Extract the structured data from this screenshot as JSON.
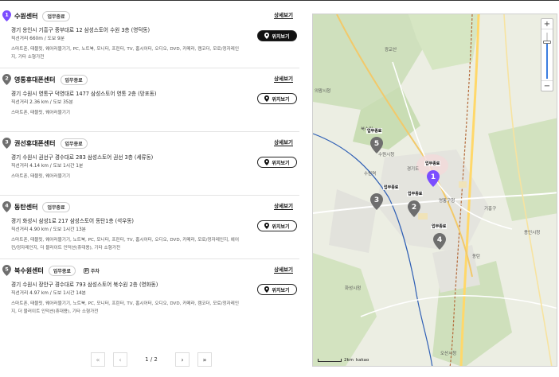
{
  "centers": [
    {
      "num": "1",
      "name": "수원센터",
      "badge": "업무종료",
      "detail_label": "상세보기",
      "address": "경기 용인시 기흥구 중부대로 12 삼성스토어 수원 3층 (영덕동)",
      "distance": "직선거리 660m / 도보 9분",
      "products": "스마트폰, 태블릿, 웨어러블기기, PC, 노트북, 모니터, 프린터, TV, 홈시어터, 오디오, DVD, 카메라, 캠코더, 모로/정자레인지, 기타 소형가전",
      "locate_label": "위치보기",
      "active": true
    },
    {
      "num": "2",
      "name": "영통휴대폰센터",
      "badge": "업무종료",
      "detail_label": "상세보기",
      "address": "경기 수원시 영통구 덕영대로 1477 삼성스토어 영통 2층 (망포동)",
      "distance": "직선거리 2.36 km / 도보 35분",
      "products": "스마트폰, 태블릿, 웨어러블기기",
      "locate_label": "위치보기",
      "active": false
    },
    {
      "num": "3",
      "name": "권선휴대폰센터",
      "badge": "업무종료",
      "detail_label": "상세보기",
      "address": "경기 수원시 권선구 경수대로 283 삼성스토어 권선 3층 (세류동)",
      "distance": "직선거리 4.14 km / 도보 1시간 1분",
      "products": "스마트폰, 태블릿, 웨어러블기기",
      "locate_label": "위치보기",
      "active": false
    },
    {
      "num": "4",
      "name": "동탄센터",
      "badge": "업무종료",
      "detail_label": "상세보기",
      "address": "경기 화성시 삼성1로 217 삼성스토어 동탄1층 (석우동)",
      "distance": "직선거리 4.90 km / 도보 1시간 13분",
      "products": "스마트폰, 태블릿, 웨어러블기기, 노트북, PC, 모니터, 프린터, TV, 홈시어터, 오디오, DVD, 카메라, 모로/정자레인지, 에어컨/정자레인지, 더 블러이트 인덕션(휴대용), 기타 소형가전",
      "locate_label": "위치보기",
      "active": false
    },
    {
      "num": "5",
      "name": "북수원센터",
      "badge": "업무종료",
      "extra_badge": "주차",
      "detail_label": "상세보기",
      "address": "경기 수원시 장안구 경수대로 793 삼성스토어 북수원 2층 (영화동)",
      "distance": "직선거리 4.97 km / 도보 1시간 14분",
      "products": "스마트폰, 태블릿, 웨어러블기기, 노트북, PC, 모니터, 프린터, TV, 홈시어터, 오디오, DVD, 카메라, 캠코더, 모로/정자레인지, 더 블러이트 인덕션(휴대용), 기타 소형가전",
      "locate_label": "위치보기",
      "active": false
    }
  ],
  "pagination": {
    "first": "«",
    "prev": "‹",
    "info": "1 / 2",
    "next": "›",
    "last": "»"
  },
  "map": {
    "zoom_in": "+",
    "zoom_out": "−",
    "zoom_level_fraction": 0.2,
    "scale_label": "2km",
    "provider": "kakao",
    "marker_status": "업무종료",
    "labels": [
      "수원시청",
      "경기도",
      "수원역",
      "광교산",
      "영통구청",
      "화성시청",
      "용인시청",
      "오산시청",
      "의왕시청",
      "북수원",
      "동탄",
      "기흥구"
    ],
    "colors": {
      "active_marker": "#7b4dff",
      "inactive_marker": "#6e6e6e",
      "road": "#ffd86a",
      "rail": "#2f5fb5"
    }
  }
}
